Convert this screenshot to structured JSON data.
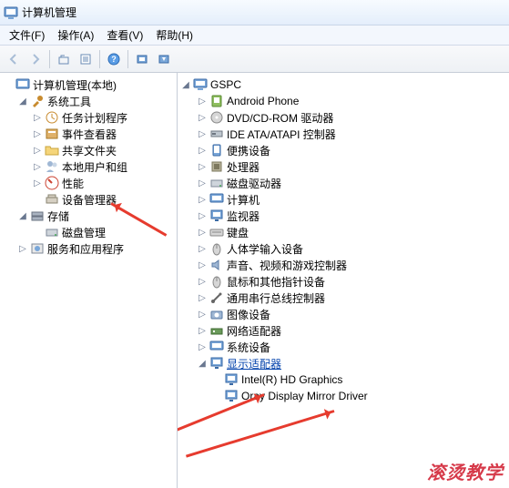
{
  "window": {
    "title": "计算机管理"
  },
  "menus": {
    "file": "文件(F)",
    "action": "操作(A)",
    "view": "查看(V)",
    "help": "帮助(H)"
  },
  "left_tree": {
    "root": "计算机管理(本地)",
    "system_tools": {
      "label": "系统工具",
      "items": {
        "task_scheduler": "任务计划程序",
        "event_viewer": "事件查看器",
        "shared_folders": "共享文件夹",
        "local_users": "本地用户和组",
        "performance": "性能",
        "device_manager": "设备管理器"
      }
    },
    "storage": {
      "label": "存储",
      "items": {
        "disk_mgmt": "磁盘管理"
      }
    },
    "services": "服务和应用程序"
  },
  "right_tree": {
    "root": "GSPC",
    "categories": {
      "android": "Android Phone",
      "dvd": "DVD/CD-ROM 驱动器",
      "ide": "IDE ATA/ATAPI 控制器",
      "portable": "便携设备",
      "cpu": "处理器",
      "diskdrive": "磁盘驱动器",
      "computer": "计算机",
      "monitor": "监视器",
      "keyboard": "键盘",
      "hid": "人体学输入设备",
      "sound": "声音、视频和游戏控制器",
      "mouse": "鼠标和其他指针设备",
      "usb": "通用串行总线控制器",
      "imaging": "图像设备",
      "network": "网络适配器",
      "system": "系统设备",
      "display": "显示适配器"
    },
    "display_children": {
      "intel": "Intel(R) HD Graphics",
      "oray": "Oray Display Mirror Driver"
    }
  },
  "watermark": "滚烫教学"
}
